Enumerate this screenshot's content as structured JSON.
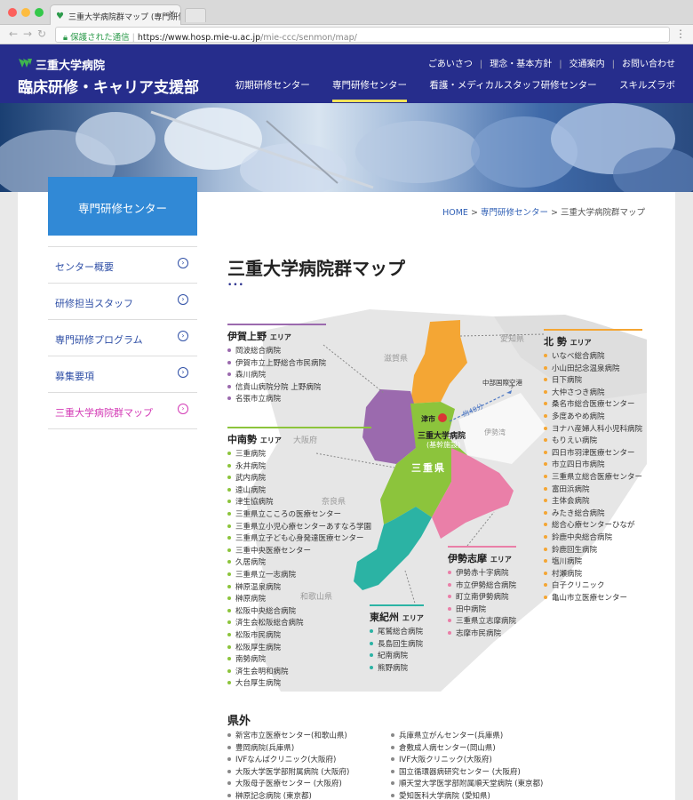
{
  "browser": {
    "tab_title": "三重大学病院群マップ (専門研修セ",
    "secure_label": "保護された通信",
    "url_host": "https://www.hosp.mie-u.ac.jp",
    "url_path": "/mie-ccc/senmon/map/"
  },
  "header": {
    "hospital_name": "三重大学病院",
    "dept_name": "臨床研修・キャリア支援部",
    "top_links": [
      "ごあいさつ",
      "理念・基本方針",
      "交通案内",
      "お問い合わせ"
    ],
    "nav": [
      "初期研修センター",
      "専門研修センター",
      "看護・メディカルスタッフ研修センター",
      "スキルズラボ"
    ],
    "active_nav": "専門研修センター",
    "brand_color": "#262d8c"
  },
  "sidebar": {
    "title": "専門研修センター",
    "items": [
      {
        "label": "センター概要"
      },
      {
        "label": "研修担当スタッフ"
      },
      {
        "label": "専門研修プログラム"
      },
      {
        "label": "募集要項"
      },
      {
        "label": "三重大学病院群マップ"
      }
    ]
  },
  "breadcrumb": {
    "home": "HOME",
    "parent": "専門研修センター",
    "current": "三重大学病院群マップ",
    "sep": ">"
  },
  "page": {
    "title": "三重大学病院群マップ",
    "dots": "•••"
  },
  "map": {
    "prefectures": {
      "shiga": "滋賀県",
      "aichi": "愛知県",
      "osaka": "大阪府",
      "nara": "奈良県",
      "wakayama": "和歌山県",
      "mie": "三重県",
      "ise_bay": "伊勢湾"
    },
    "tsu_label": "津市",
    "main_hospital": "三重大学病院",
    "main_hospital_sub": "(基幹施設)",
    "airport": "中部国際空港",
    "airport_time": "約40分"
  },
  "areas": {
    "iga": {
      "name": "伊賀上野",
      "suffix": "エリア",
      "color": "#9b6aae",
      "hospitals": [
        "岡波総合病院",
        "伊賀市立上野総合市民病院",
        "森川病院",
        "信貴山病院分院 上野病院",
        "名張市立病院"
      ]
    },
    "chunan": {
      "name": "中南勢",
      "suffix": "エリア",
      "color": "#8cc43c",
      "hospitals": [
        "三重病院",
        "永井病院",
        "武内病院",
        "遠山病院",
        "津生協病院",
        "三重県立こころの医療センター",
        "三重県立小児心療センターあすなろ学園",
        "三重県立子ども心身発達医療センター",
        "三重中央医療センター",
        "久居病院",
        "三重県立一志病院",
        "榊原温泉病院",
        "榊原病院",
        "松阪中央総合病院",
        "済生会松阪総合病院",
        "松阪市民病院",
        "松阪厚生病院",
        "南勢病院",
        "済生会明和病院",
        "大台厚生病院"
      ]
    },
    "hokusei": {
      "name": "北 勢",
      "suffix": "エリア",
      "color": "#f4a634",
      "hospitals": [
        "いなべ総合病院",
        "小山田記念温泉病院",
        "日下病院",
        "大仲さつき病院",
        "桑名市総合医療センター",
        "多度あやめ病院",
        "ヨナハ産婦人科小児科病院",
        "もりえい病院",
        "四日市羽津医療センター",
        "市立四日市病院",
        "三重県立総合医療センター",
        "富田浜病院",
        "主体会病院",
        "みたき総合病院",
        "総合心療センターひなが",
        "鈴鹿中央総合病院",
        "鈴鹿回生病院",
        "塩川病院",
        "村瀬病院",
        "白子クリニック",
        "亀山市立医療センター"
      ]
    },
    "iseshima": {
      "name": "伊勢志摩",
      "suffix": "エリア",
      "color": "#ea7fa8",
      "hospitals": [
        "伊勢赤十字病院",
        "市立伊勢総合病院",
        "町立南伊勢病院",
        "田中病院",
        "三重県立志摩病院",
        "志摩市民病院"
      ]
    },
    "higashikishu": {
      "name": "東紀州",
      "suffix": "エリア",
      "color": "#2bb3a4",
      "hospitals": [
        "尾鷲総合病院",
        "長島回生病院",
        "紀南病院",
        "熊野病院"
      ]
    }
  },
  "outside": {
    "title": "県外",
    "left": [
      "新宮市立医療センター(和歌山県)",
      "豊岡病院(兵庫県)",
      "IVFなんばクリニック(大阪府)",
      "大阪大学医学部附属病院 (大阪府)",
      "大阪母子医療センター (大阪府)",
      "榊原記念病院 (東京都)"
    ],
    "right": [
      "兵庫県立がんセンター(兵庫県)",
      "倉敷成人病センター(岡山県)",
      "IVF大阪クリニック(大阪府)",
      "国立循環器病研究センター (大阪府)",
      "順天堂大学医学部附属順天堂病院 (東京都)",
      "愛知医科大学病院 (愛知県)"
    ]
  }
}
